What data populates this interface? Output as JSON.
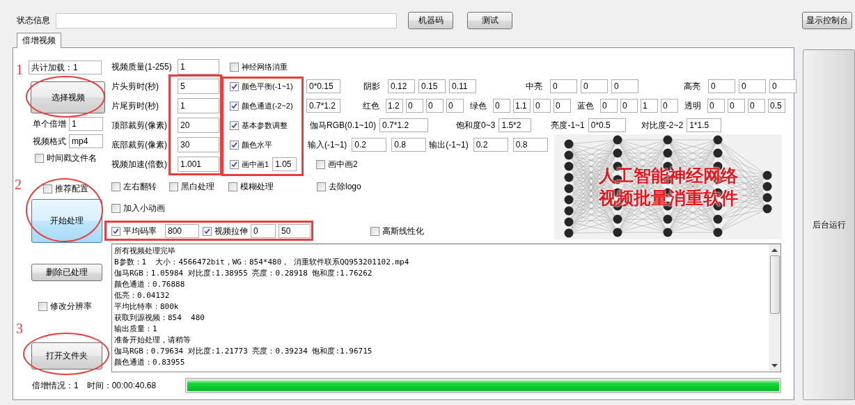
{
  "top_bar": {
    "status_label": "状态信息",
    "buttons": [
      "机器码",
      "测试"
    ],
    "console_button": "显示控制台"
  },
  "tabs": [
    {
      "label": "倍增视频",
      "selected": true
    }
  ],
  "side_button": "后台运行",
  "left_panel": {
    "total_loaded": "共计加载：1",
    "select_button": "选择视频",
    "multiplier": {
      "label": "单个倍增",
      "value": "1"
    },
    "format": {
      "label": "视频格式",
      "value": "mp4"
    },
    "timestamp": {
      "label": "时间戳文件名",
      "checked": false
    },
    "recommended": {
      "label": "推荐配置",
      "checked": false
    },
    "start_button": "开始处理",
    "delete_button": "删除已处理",
    "resolution": {
      "label": "修改分辨率",
      "checked": false
    },
    "open_button": "打开文件夹"
  },
  "params": [
    {
      "label": "视频质量(1-255)",
      "value": "1"
    },
    {
      "label": "片头剪时(秒)",
      "value": "5"
    },
    {
      "label": "片尾剪时(秒)",
      "value": "1"
    },
    {
      "label": "顶部裁剪(像素)",
      "value": "20"
    },
    {
      "label": "底部裁剪(像素)",
      "value": "30"
    },
    {
      "label": "视频加速(倍数)",
      "value": "1.001"
    }
  ],
  "effects": [
    {
      "label": "神经网络消重",
      "checked": false
    },
    {
      "label": "颜色平衡(-1~1)",
      "checked": true,
      "value": "0*0.15"
    },
    {
      "label": "颜色通道(-2~2)",
      "checked": true,
      "value": "0.7*1.2"
    },
    {
      "label": "基本参数调整",
      "checked": true
    },
    {
      "label": "颜色水平",
      "checked": true
    },
    {
      "label": "画中画1",
      "checked": true,
      "value": "1.05"
    }
  ],
  "adjust_rows": [
    {
      "groups": [
        {
          "label": "阴影",
          "values": [
            "0.12",
            "0.15",
            "0.11"
          ]
        },
        {
          "label": "中亮",
          "values": [
            "0",
            "0",
            "0"
          ]
        },
        {
          "label": "高亮",
          "values": [
            "0",
            "0",
            "0"
          ]
        }
      ]
    },
    {
      "groups": [
        {
          "label": "红色",
          "values": [
            "1.2",
            "0",
            "0",
            "0"
          ]
        },
        {
          "label": "绿色",
          "values": [
            "0",
            "1.1",
            "0",
            "0"
          ]
        },
        {
          "label": "蓝色",
          "values": [
            "0",
            "0",
            "1",
            "0"
          ]
        },
        {
          "label": "透明",
          "values": [
            "0",
            "0",
            "0",
            "0.5"
          ]
        }
      ]
    },
    {
      "groups": [
        {
          "label": "伽马RGB(0.1~10)",
          "values": [
            "0.7*1.2"
          ]
        },
        {
          "label": "饱和度0~3",
          "values": [
            "1.5*2"
          ]
        },
        {
          "label": "亮度-1~1",
          "values": [
            "0*0.5"
          ]
        },
        {
          "label": "对比度-2~2",
          "values": [
            "1*1.5"
          ]
        }
      ]
    },
    {
      "groups": [
        {
          "label": "输入(-1~1)",
          "values": [
            "0.2",
            "0.8"
          ]
        },
        {
          "label": "输出(-1~1)",
          "values": [
            "0.2",
            "0.8"
          ]
        }
      ]
    }
  ],
  "pip2": {
    "label": "画中画2",
    "checked": false
  },
  "options": [
    {
      "label": "左右翻转",
      "checked": false
    },
    {
      "label": "黑白处理",
      "checked": false
    },
    {
      "label": "模糊处理",
      "checked": false
    },
    {
      "label": "去除logo",
      "checked": false
    }
  ],
  "animation": {
    "label": "加入小动画",
    "checked": false
  },
  "bitrate": {
    "label": "平均码率",
    "checked": true,
    "value": "800"
  },
  "stretch": {
    "label": "视频拉伸",
    "checked": true,
    "values": [
      "0",
      "50"
    ]
  },
  "gaussian": {
    "label": "高斯线性化",
    "checked": false
  },
  "banner": {
    "lines": [
      "人工智能神经网络",
      "视频批量消重软件"
    ]
  },
  "log_lines": [
    "所有视频处理完毕",
    "B参数：1  大小：4566472bit，WG：854*480， 消重软件联系QQ953201102.mp4",
    "伽马RGB：1.05984 对比度:1.38955 亮度：0.28918 饱和度:1.76262",
    "颜色通道：0.76888",
    "低亮：0.04132",
    "平均比特率：800k",
    "获取到源视频：854  480",
    "输出质量：1",
    "准备开始处理，请稍等",
    "伽马RGB：0.79634 对比度:1.21773 亮度：0.39234 饱和度:1.96715",
    "颜色通道：0.83955"
  ],
  "status": {
    "multiplier": "倍增情况：1",
    "time": "时间：00:00:40.68"
  },
  "progress": {
    "level": 1
  },
  "annotations": {
    "numbers": [
      "1",
      "2",
      "3"
    ]
  }
}
